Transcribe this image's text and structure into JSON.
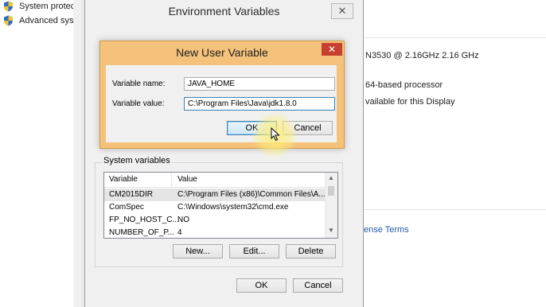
{
  "background_window": {
    "left_items": [
      {
        "label": "System protec",
        "icon": "shield-icon"
      },
      {
        "label": "Advanced syst",
        "icon": "shield-icon"
      }
    ],
    "right_texts": {
      "processor": "N3530 @ 2.16GHz   2.16 GHz",
      "system_type": "64-based processor",
      "pen_touch": "vailable for this Display",
      "license_link": "ense Terms"
    }
  },
  "env_dialog": {
    "title": "Environment Variables",
    "close_symbol": "✕",
    "system_variables_label": "System variables",
    "columns": [
      "Variable",
      "Value"
    ],
    "rows": [
      {
        "variable": "CM2015DIR",
        "value": "C:\\Program Files (x86)\\Common Files\\A...",
        "selected": true
      },
      {
        "variable": "ComSpec",
        "value": "C:\\Windows\\system32\\cmd.exe",
        "selected": false
      },
      {
        "variable": "FP_NO_HOST_C...",
        "value": "NO",
        "selected": false
      },
      {
        "variable": "NUMBER_OF_P...",
        "value": "4",
        "selected": false
      }
    ],
    "buttons": {
      "new": "New...",
      "edit": "Edit...",
      "delete": "Delete",
      "ok": "OK",
      "cancel": "Cancel"
    }
  },
  "new_user_variable": {
    "title": "New User Variable",
    "close_symbol": "✕",
    "name_label": "Variable name:",
    "name_value": "JAVA_HOME",
    "value_label": "Variable value:",
    "value_value": "C:\\Program Files\\Java\\jdk1.8.0",
    "ok": "OK",
    "cancel": "Cancel"
  },
  "colors": {
    "dialog_accent": "#f4c27a",
    "close_button": "#c7402f",
    "link": "#1f5aa8"
  }
}
